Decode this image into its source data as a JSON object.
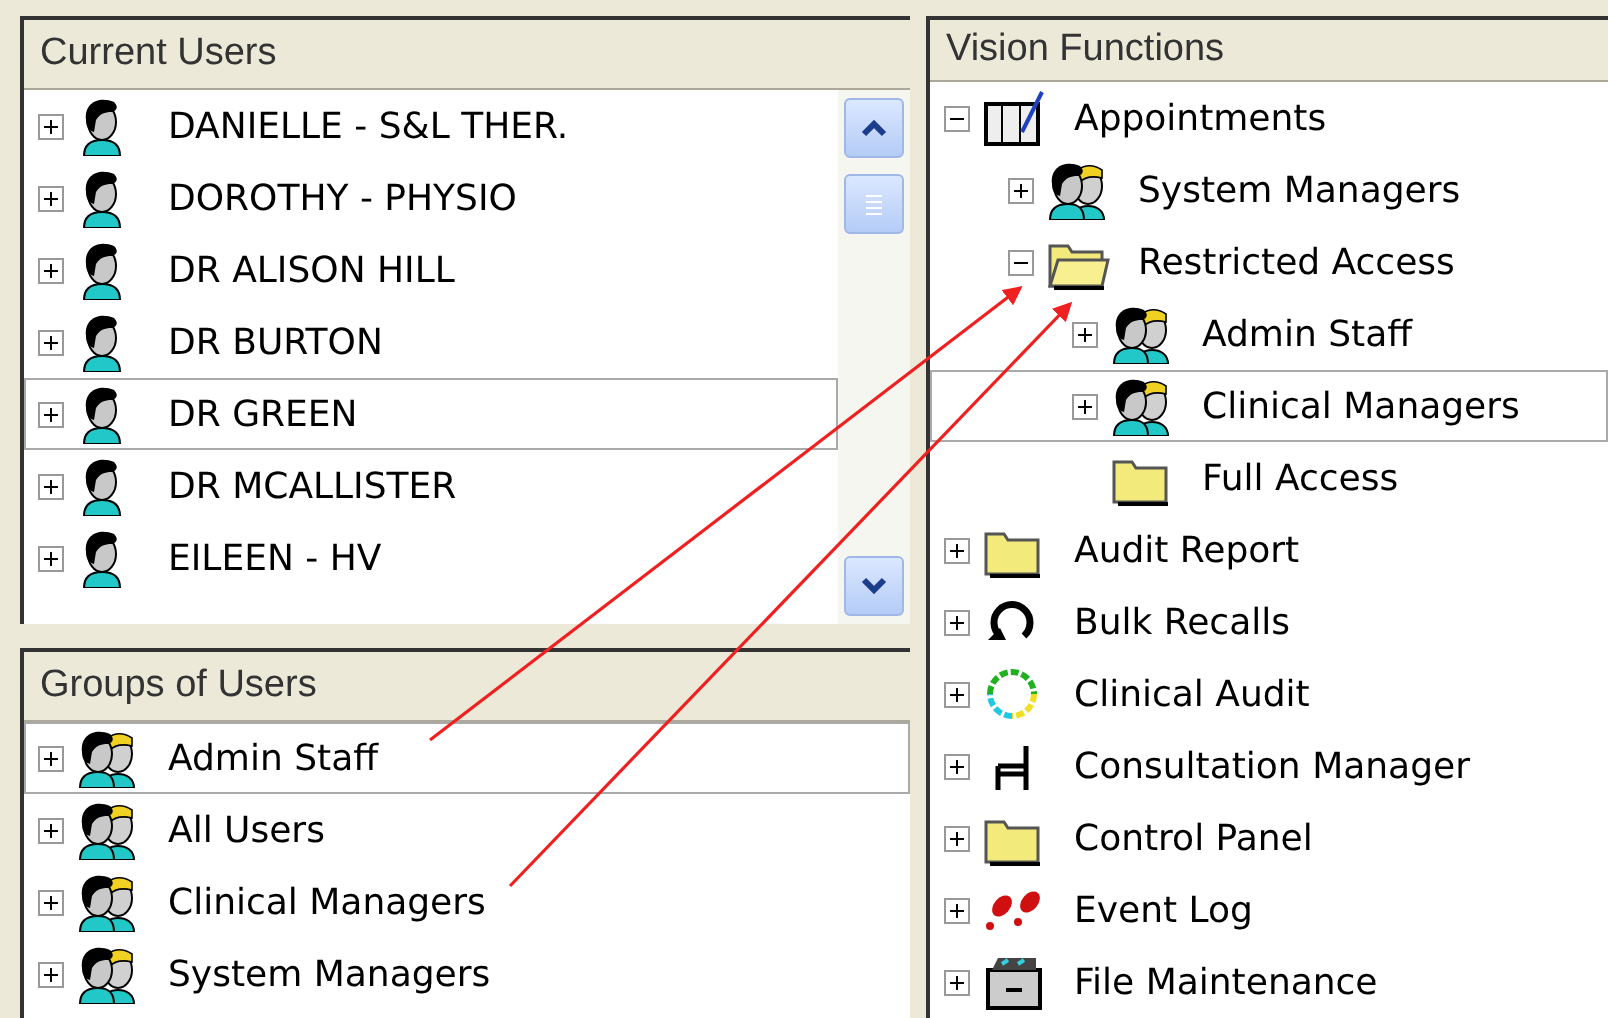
{
  "current_users": {
    "title": "Current Users",
    "items": [
      {
        "label": "DANIELLE - S&L THER.",
        "kind": "user",
        "expanded": false,
        "selected": false
      },
      {
        "label": "DOROTHY - PHYSIO",
        "kind": "user",
        "expanded": false,
        "selected": false
      },
      {
        "label": "DR ALISON HILL",
        "kind": "user",
        "expanded": false,
        "selected": false
      },
      {
        "label": "DR BURTON",
        "kind": "user",
        "expanded": false,
        "selected": false
      },
      {
        "label": "DR GREEN",
        "kind": "user",
        "expanded": false,
        "selected": true
      },
      {
        "label": "DR MCALLISTER",
        "kind": "user",
        "expanded": false,
        "selected": false
      },
      {
        "label": "EILEEN - HV",
        "kind": "user",
        "expanded": false,
        "selected": false
      }
    ]
  },
  "groups_of_users": {
    "title": "Groups of Users",
    "items": [
      {
        "label": "Admin Staff",
        "kind": "group",
        "expanded": false,
        "selected": true
      },
      {
        "label": "All Users",
        "kind": "group",
        "expanded": false,
        "selected": false
      },
      {
        "label": "Clinical Managers",
        "kind": "group",
        "expanded": false,
        "selected": false
      },
      {
        "label": "System Managers",
        "kind": "group",
        "expanded": false,
        "selected": false
      }
    ]
  },
  "vision_functions": {
    "title": "Vision Functions",
    "items": [
      {
        "label": "Appointments",
        "kind": "calendar",
        "expanded": true,
        "selected": false,
        "children": [
          {
            "label": "System Managers",
            "kind": "group",
            "expanded": false,
            "selected": false
          },
          {
            "label": "Restricted Access",
            "kind": "open-folder",
            "expanded": true,
            "selected": false,
            "children": [
              {
                "label": "Admin Staff",
                "kind": "group",
                "expanded": false,
                "selected": false
              },
              {
                "label": "Clinical Managers",
                "kind": "group",
                "expanded": false,
                "selected": true
              },
              {
                "label": "Full Access",
                "kind": "folder",
                "selected": false
              }
            ]
          }
        ]
      },
      {
        "label": "Audit Report",
        "kind": "folder",
        "expanded": false,
        "selected": false
      },
      {
        "label": "Bulk Recalls",
        "kind": "recall",
        "expanded": false,
        "selected": false
      },
      {
        "label": "Clinical Audit",
        "kind": "ring",
        "expanded": false,
        "selected": false
      },
      {
        "label": "Consultation Manager",
        "kind": "chair",
        "expanded": false,
        "selected": false
      },
      {
        "label": "Control Panel",
        "kind": "folder",
        "expanded": false,
        "selected": false
      },
      {
        "label": "Event Log",
        "kind": "footprints",
        "expanded": false,
        "selected": false
      },
      {
        "label": "File Maintenance",
        "kind": "drawer",
        "expanded": false,
        "selected": false
      }
    ]
  }
}
